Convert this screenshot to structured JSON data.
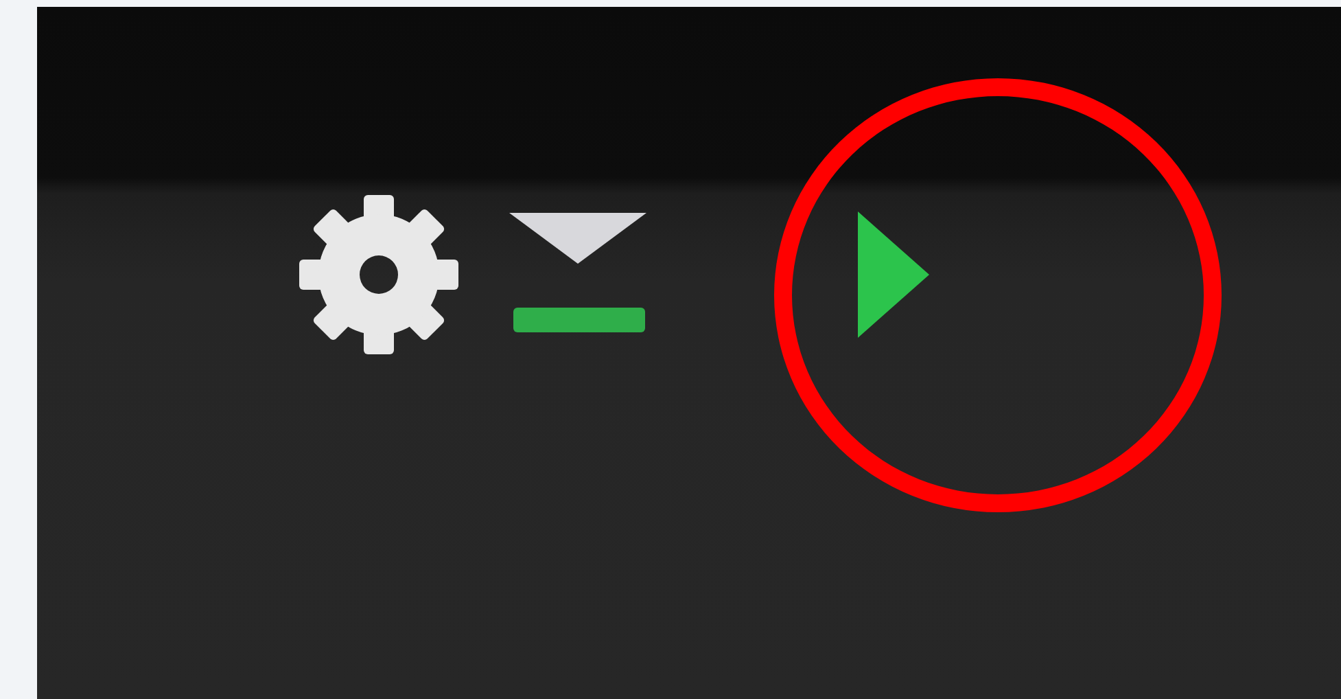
{
  "toolbar": {
    "icons": [
      {
        "kind": "gear"
      },
      {
        "kind": "download"
      },
      {
        "kind": "play"
      }
    ]
  },
  "annotation": {
    "kind": "circle"
  }
}
